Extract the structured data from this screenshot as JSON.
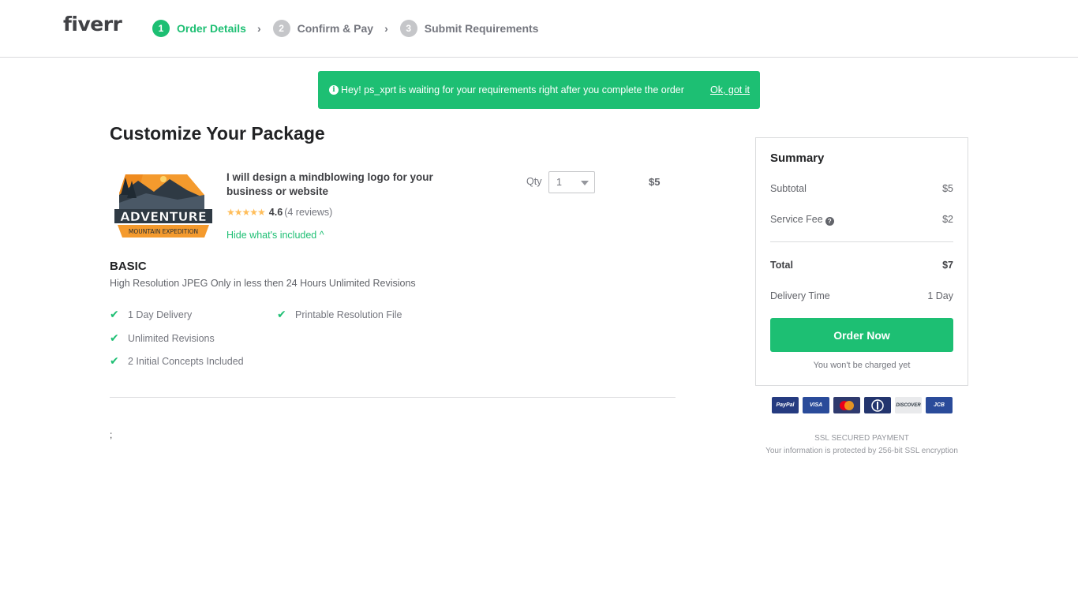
{
  "header": {
    "logo": "fiverr",
    "steps": [
      {
        "num": "1",
        "label": "Order Details"
      },
      {
        "num": "2",
        "label": "Confirm & Pay"
      },
      {
        "num": "3",
        "label": "Submit Requirements"
      }
    ]
  },
  "notice": {
    "text": "Hey! ps_xprt is waiting for your requirements right after you complete the order",
    "link": "Ok, got it"
  },
  "main": {
    "title": "Customize Your Package",
    "gig": {
      "title": "I will design a mindblowing logo for your business or website",
      "rating": "4.6",
      "reviews": "(4 reviews)",
      "stars": 4.6,
      "hide_link": "Hide what's included ^",
      "image_text": [
        "ADVENTURE",
        "MOUNTAIN EXPEDITION"
      ]
    },
    "qty": {
      "label": "Qty",
      "value": "1"
    },
    "price": "$5",
    "package": {
      "name": "BASIC",
      "description": "High Resolution JPEG Only in less then 24 Hours Unlimited Revisions",
      "features": [
        "1 Day Delivery",
        "Printable Resolution File",
        "Unlimited Revisions",
        "2 Initial Concepts Included"
      ]
    },
    "stray_text": ";"
  },
  "summary": {
    "title": "Summary",
    "subtotal_label": "Subtotal",
    "subtotal": "$5",
    "fee_label": "Service Fee",
    "fee": "$2",
    "total_label": "Total",
    "total": "$7",
    "delivery_label": "Delivery Time",
    "delivery": "1 Day",
    "order_button": "Order Now",
    "note": "You won't be charged yet"
  },
  "payment": {
    "methods": [
      "PayPal",
      "VISA",
      "MasterCard",
      "Diners",
      "DISCOVER",
      "JCB"
    ],
    "ssl_title": "SSL SECURED PAYMENT",
    "ssl_desc": "Your information is protected by 256-bit SSL encryption"
  },
  "colors": {
    "accent": "#1dbf73",
    "star": "#ffbe5b"
  }
}
